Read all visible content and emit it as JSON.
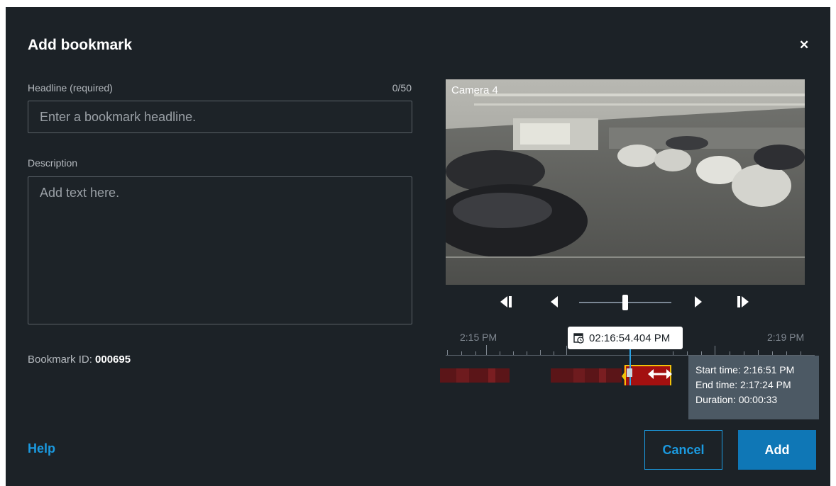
{
  "dialog": {
    "title": "Add bookmark",
    "close_icon": "close-icon"
  },
  "headline": {
    "label": "Headline (required)",
    "counter": "0/50",
    "placeholder": "Enter a bookmark headline.",
    "value": ""
  },
  "description": {
    "label": "Description",
    "placeholder": "Add text here.",
    "value": ""
  },
  "bookmark_id": {
    "label": "Bookmark ID: ",
    "value": "000695"
  },
  "video": {
    "camera_label": "Camera 4"
  },
  "playback": {
    "icons": [
      "step-back-icon",
      "play-reverse-icon",
      "speed-slider",
      "play-icon",
      "step-forward-icon"
    ]
  },
  "timeline": {
    "tick_left": "2:15 PM",
    "tick_right": "2:19 PM",
    "current_time": "02:16:54.404 PM",
    "clock_icon": "calendar-clock-icon",
    "colors": {
      "recording": "#a31010",
      "recording_dim": "#5b1518",
      "selection": "#f2c10a",
      "playhead": "#2aa3e6"
    }
  },
  "tooltip": {
    "start": "Start time: 2:16:51 PM",
    "end": "End time: 2:17:24 PM",
    "duration": "Duration: 00:00:33"
  },
  "footer": {
    "help": "Help",
    "cancel": "Cancel",
    "add": "Add"
  },
  "colors": {
    "background": "#1c2227",
    "accent": "#1b9ae0",
    "primary_button": "#0f77b6"
  }
}
